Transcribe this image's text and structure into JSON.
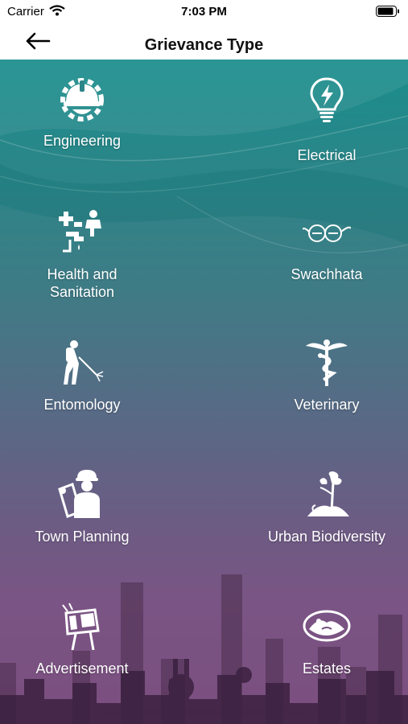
{
  "status": {
    "carrier": "Carrier",
    "time": "7:03 PM"
  },
  "header": {
    "title": "Grievance Type"
  },
  "tiles": [
    {
      "label": "Engineering",
      "icon": "helmet-gear-icon"
    },
    {
      "label": "Electrical",
      "icon": "bulb-bolt-icon"
    },
    {
      "label": "Health and\nSanitation",
      "icon": "health-sanitation-icon"
    },
    {
      "label": "Swachhata",
      "icon": "swachh-glasses-icon"
    },
    {
      "label": "Entomology",
      "icon": "sprayer-person-icon"
    },
    {
      "label": "Veterinary",
      "icon": "caduceus-icon"
    },
    {
      "label": "Town Planning",
      "icon": "planner-worker-icon"
    },
    {
      "label": "Urban Biodiversity",
      "icon": "tree-icon"
    },
    {
      "label": "Advertisement",
      "icon": "billboard-icon"
    },
    {
      "label": "Estates",
      "icon": "estates-emblem-icon"
    }
  ],
  "colors": {
    "teal": "#1a8d8c",
    "purple": "#7b4f7f",
    "white": "#ffffff"
  }
}
